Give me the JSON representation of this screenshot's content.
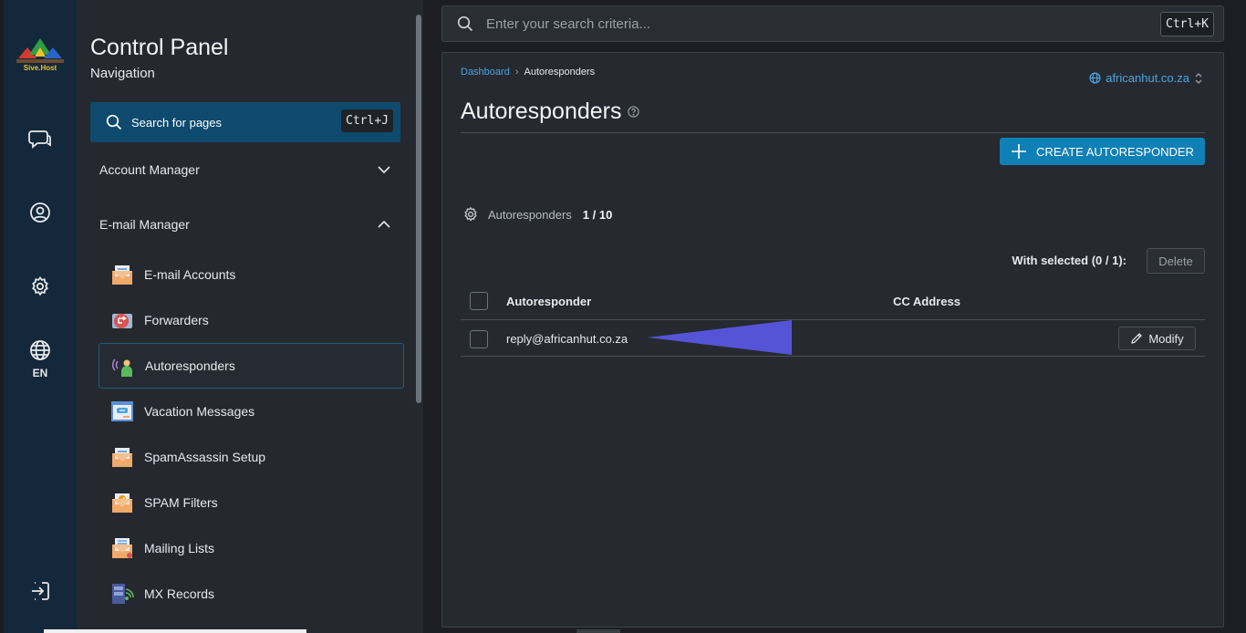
{
  "brand": {
    "logo_text": "Sive.Host"
  },
  "rail": {
    "language": "EN"
  },
  "nav": {
    "title": "Control Panel",
    "subtitle": "Navigation",
    "search_label": "Search for pages",
    "search_shortcut": "Ctrl+J",
    "sections": [
      {
        "label": "Account Manager",
        "expanded": false
      },
      {
        "label": "E-mail Manager",
        "expanded": true
      }
    ],
    "items": [
      {
        "label": "E-mail Accounts",
        "icon": "email-accounts-icon"
      },
      {
        "label": "Forwarders",
        "icon": "forwarders-icon"
      },
      {
        "label": "Autoresponders",
        "icon": "autoresponders-icon",
        "active": true
      },
      {
        "label": "Vacation Messages",
        "icon": "vacation-messages-icon"
      },
      {
        "label": "SpamAssassin Setup",
        "icon": "spamassassin-icon"
      },
      {
        "label": "SPAM Filters",
        "icon": "spam-filters-icon"
      },
      {
        "label": "Mailing Lists",
        "icon": "mailing-lists-icon"
      },
      {
        "label": "MX Records",
        "icon": "mx-records-icon"
      }
    ]
  },
  "top_search": {
    "placeholder": "Enter your search criteria...",
    "shortcut": "Ctrl+K"
  },
  "main": {
    "breadcrumb": {
      "root": "Dashboard",
      "current": "Autoresponders"
    },
    "domain": "africanhut.co.za",
    "title": "Autoresponders",
    "create_button": "CREATE AUTORESPONDER",
    "count_label": "Autoresponders",
    "count_value": "1 / 10",
    "with_selected": "With selected (0 / 1):",
    "delete_button": "Delete",
    "columns": {
      "autoresponder": "Autoresponder",
      "cc": "CC Address"
    },
    "rows": [
      {
        "autoresponder": "reply@africanhut.co.za",
        "cc": "",
        "action": "Modify"
      }
    ]
  },
  "colors": {
    "rail_bg": "#13283b",
    "nav_bg": "#25292f",
    "accent": "#0f80b5",
    "link": "#4aa3df",
    "annotation_arrow": "#5553d6"
  }
}
